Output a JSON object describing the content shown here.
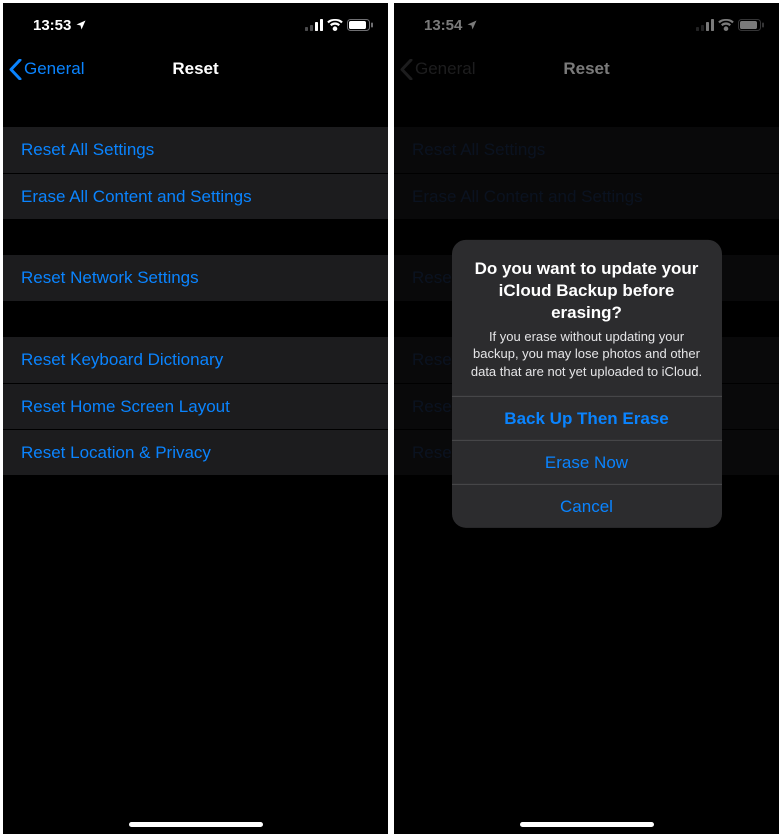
{
  "left": {
    "status": {
      "time": "13:53"
    },
    "nav": {
      "back": "General",
      "title": "Reset"
    },
    "groups": [
      [
        "Reset All Settings",
        "Erase All Content and Settings"
      ],
      [
        "Reset Network Settings"
      ],
      [
        "Reset Keyboard Dictionary",
        "Reset Home Screen Layout",
        "Reset Location & Privacy"
      ]
    ]
  },
  "right": {
    "status": {
      "time": "13:54"
    },
    "nav": {
      "back": "General",
      "title": "Reset"
    },
    "groups": [
      [
        "Reset All Settings",
        "Erase All Content and Settings"
      ],
      [
        "Reset Network Settings"
      ],
      [
        "Reset Keyboard Dictionary",
        "Reset Home Screen Layout",
        "Reset Location & Privacy"
      ]
    ],
    "alert": {
      "title": "Do you want to update your iCloud Backup before erasing?",
      "message": "If you erase without updating your backup, you may lose photos and other data that are not yet uploaded to iCloud.",
      "buttons": [
        "Back Up Then Erase",
        "Erase Now",
        "Cancel"
      ]
    }
  }
}
